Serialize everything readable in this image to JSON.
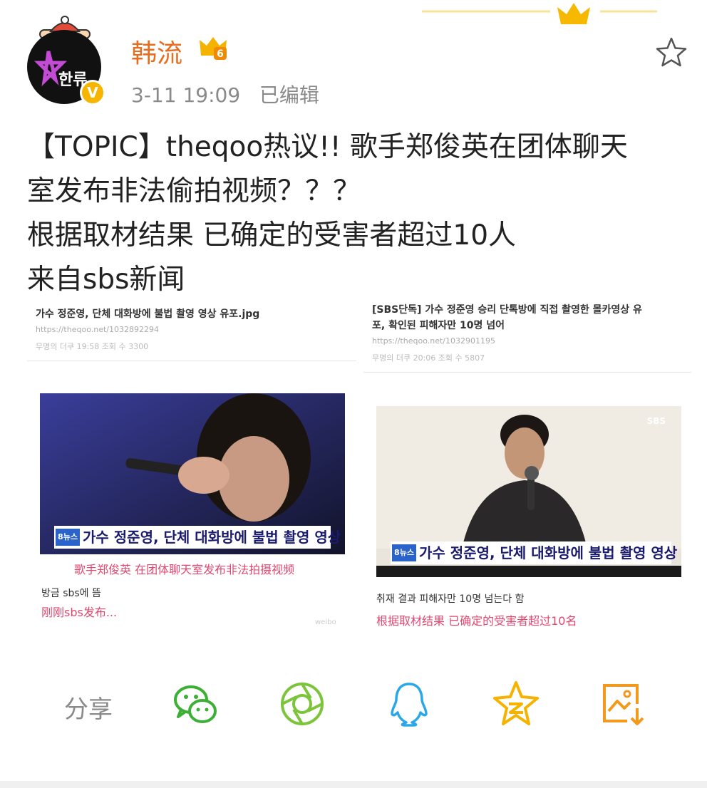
{
  "user": {
    "name": "韩流",
    "avatar_text": "한류",
    "verified": "V",
    "level": "6",
    "post_time": "3-11 19:09",
    "edited_label": "已编辑"
  },
  "post": {
    "lines": [
      "【TOPIC】theqoo热议!! 歌手郑俊英在团体聊天",
      "室发布非法偷拍视频？？？",
      "根据取材结果 已确定的受害者超过10人",
      "来自sbs新闻"
    ]
  },
  "images": {
    "left": {
      "title": "가수 정준영, 단체 대화방에 불법 촬영 영상 유포.jpg",
      "url": "https://theqoo.net/1032892294",
      "info": "무명의 더쿠   19:58   조회 수 3300",
      "channel": "8뉴스",
      "caption": "가수 정준영, 단체 대화방에 불법 촬영 영상 유포",
      "pink_caption": "歌手郑俊英 在团体聊天室发布非法拍摄视频",
      "small_kr": "방금 sbs에 뜸",
      "small_cn": "刚刚sbs发布...",
      "watermark": "weibo"
    },
    "right": {
      "title_line1": "[SBS단독] 가수 정준영 승리 단톡방에 직접 촬영한 몰카영상 유",
      "title_line2": "포, 확인된 피해자만 10명 넘어",
      "url": "https://theqoo.net/1032901195",
      "info": "무명의 더쿠   20:06   조회 수 5807",
      "channel": "8뉴스",
      "logo": "SBS",
      "caption": "가수 정준영, 단체 대화방에 불법 촬영 영상 유포",
      "small_kr": "취재 결과 피해자만 10명 넘는다 함",
      "pink_caption": "根据取材结果 已确定的受害者超过10名"
    }
  },
  "share": {
    "label": "分享",
    "icons": [
      "wechat-icon",
      "moments-icon",
      "qq-icon",
      "qzone-icon",
      "save-image-icon"
    ]
  },
  "colors": {
    "username": "#e86c1e",
    "meta": "#8a8a8a",
    "wechat": "#3cb034",
    "moments": "#7cc43a",
    "qq": "#2aa7e8",
    "qzone": "#f5b300",
    "save": "#f29a1e",
    "pink": "#e0486f"
  }
}
